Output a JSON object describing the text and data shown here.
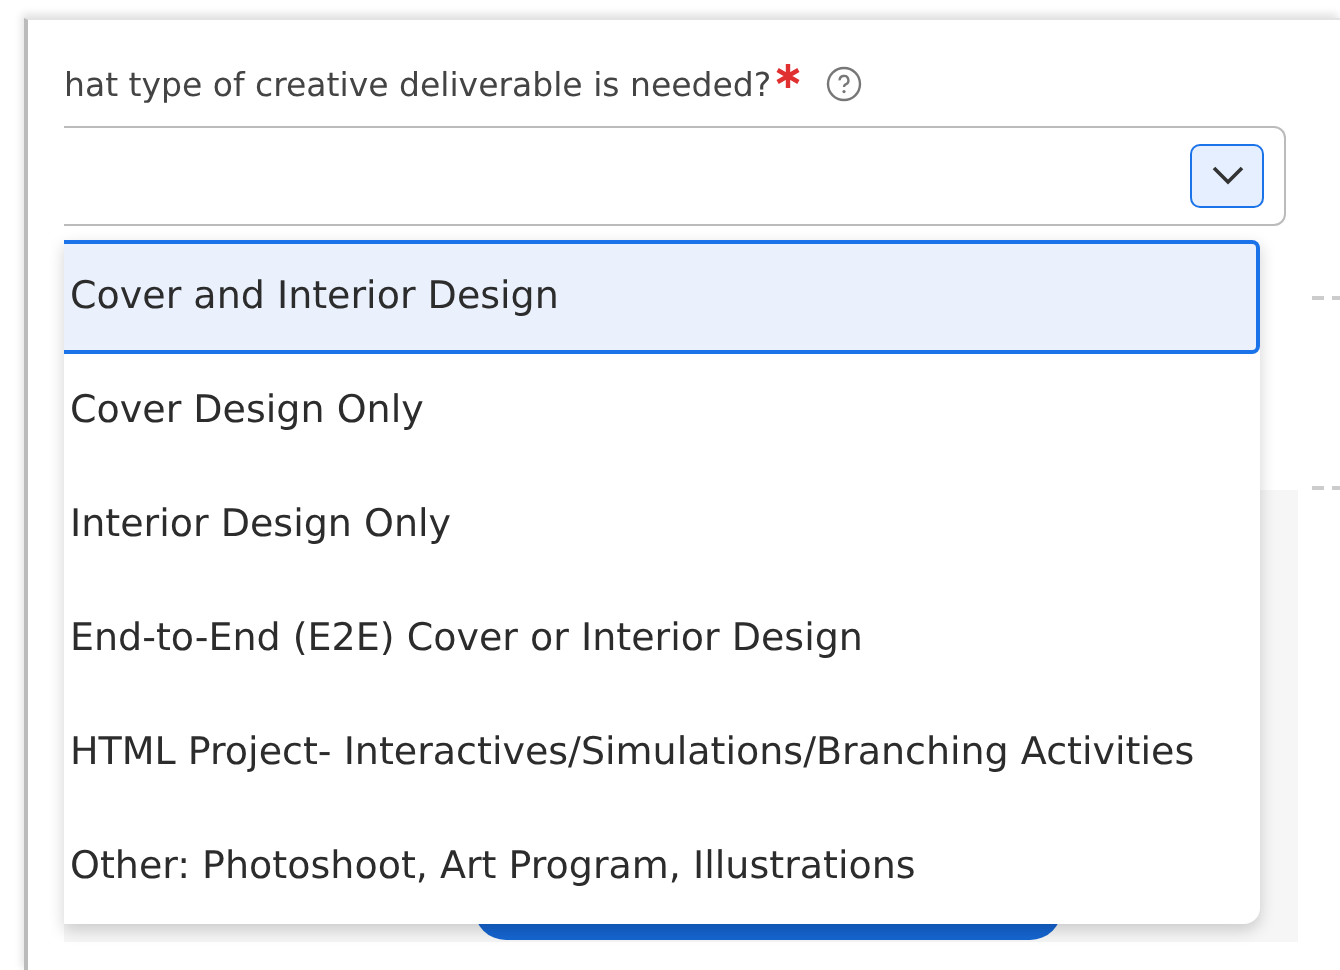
{
  "field": {
    "label": "hat type of creative deliverable is needed?",
    "required": true,
    "expanded": true
  },
  "options": [
    {
      "label": "Cover and Interior Design",
      "selected": true
    },
    {
      "label": "Cover Design Only",
      "selected": false
    },
    {
      "label": "Interior Design Only",
      "selected": false
    },
    {
      "label": "End-to-End (E2E) Cover or Interior Design",
      "selected": false
    },
    {
      "label": "HTML Project- Interactives/Simulations/Branching Activities",
      "selected": false
    },
    {
      "label": "Other: Photoshoot, Art Program, Illustrations",
      "selected": false
    }
  ]
}
